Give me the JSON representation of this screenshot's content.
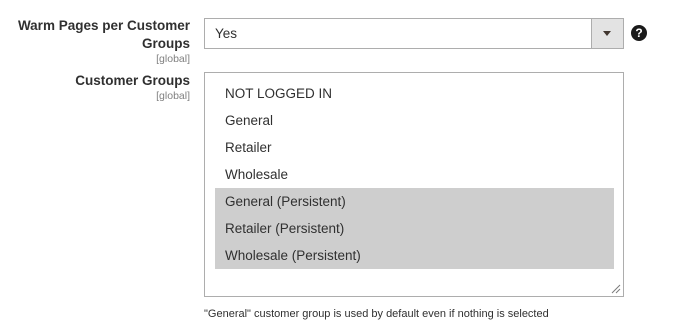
{
  "warm_pages_field": {
    "label": "Warm Pages per Customer Groups",
    "scope": "[global]",
    "selected_value": "Yes",
    "help_icon": "question-circle-icon"
  },
  "customer_groups_field": {
    "label": "Customer Groups",
    "scope": "[global]",
    "options": [
      {
        "label": "NOT LOGGED IN",
        "selected": false
      },
      {
        "label": "General",
        "selected": false
      },
      {
        "label": "Retailer",
        "selected": false
      },
      {
        "label": "Wholesale",
        "selected": false
      },
      {
        "label": "General (Persistent)",
        "selected": true
      },
      {
        "label": "Retailer (Persistent)",
        "selected": true
      },
      {
        "label": "Wholesale (Persistent)",
        "selected": true
      }
    ],
    "note": "\"General\" customer group is used by default even if nothing is selected"
  },
  "colors": {
    "selected_option_bg": "#cecece",
    "border": "#adadad",
    "arrow_box_bg": "#e3e3e3"
  }
}
